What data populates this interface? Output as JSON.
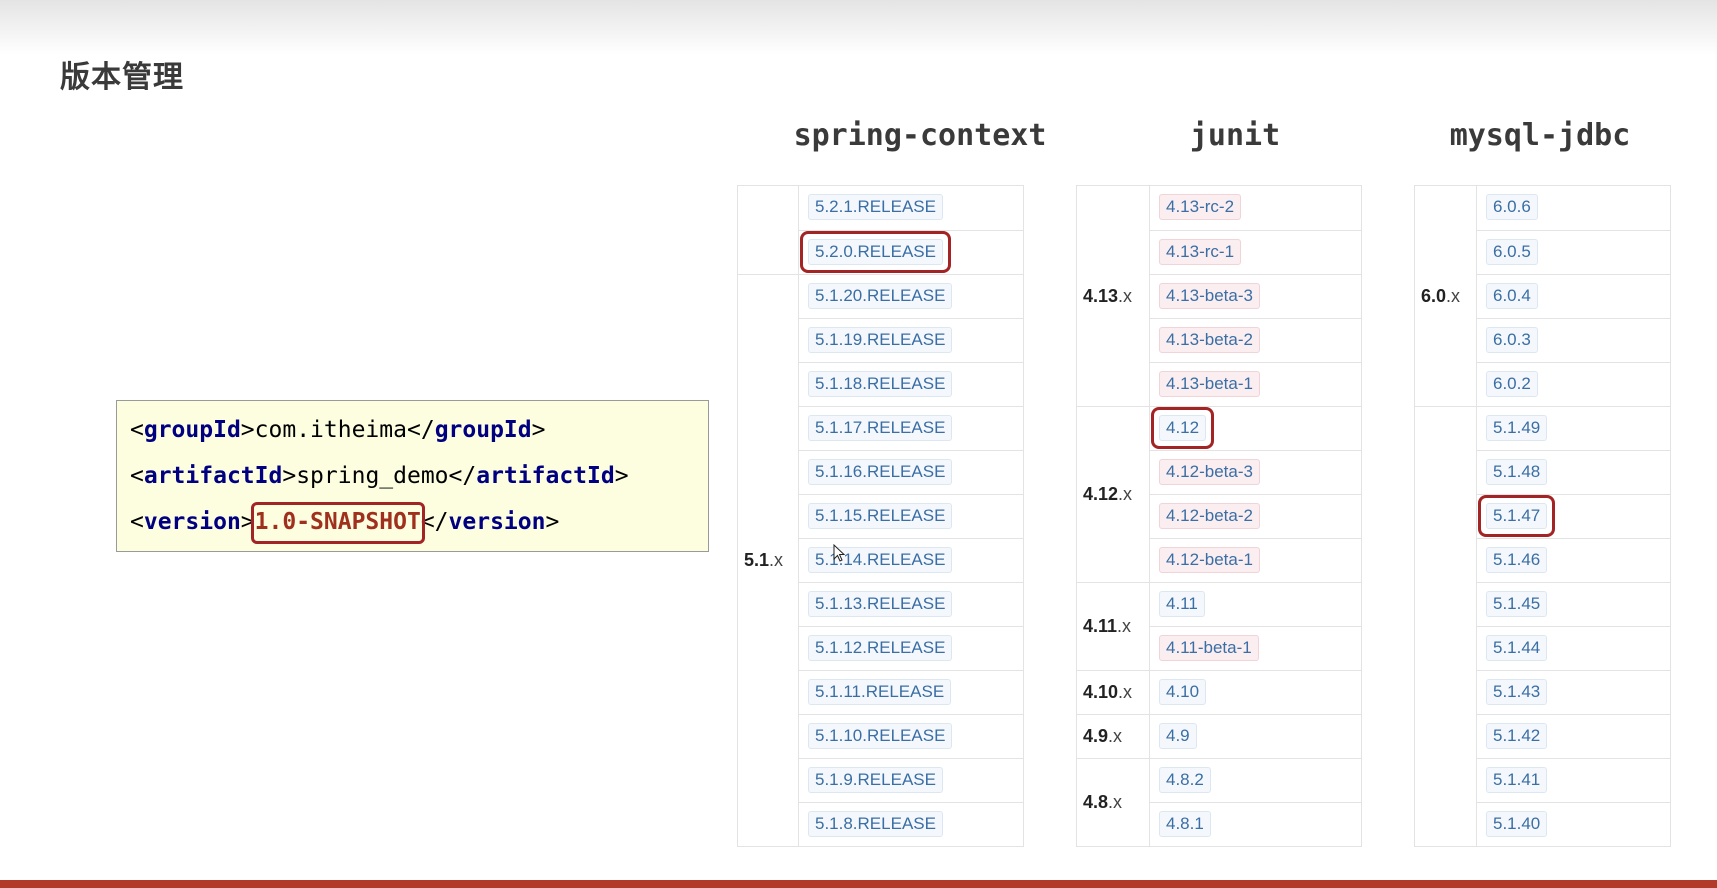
{
  "title": "版本管理",
  "code": {
    "lines": [
      {
        "open": "groupId",
        "value": "com.itheima",
        "close": "groupId"
      },
      {
        "open": "artifactId",
        "value": "spring_demo",
        "close": "artifactId"
      },
      {
        "open": "version",
        "value": "1.0-SNAPSHOT",
        "close": "version"
      }
    ]
  },
  "columns": [
    {
      "name": "spring-context",
      "groups": [
        {
          "label": "",
          "suffix": "",
          "versions": [
            "5.2.1.RELEASE",
            "5.2.0.RELEASE"
          ]
        },
        {
          "label": "5.1",
          "suffix": ".x",
          "versions": [
            "5.1.20.RELEASE",
            "5.1.19.RELEASE",
            "5.1.18.RELEASE",
            "5.1.17.RELEASE",
            "5.1.16.RELEASE",
            "5.1.15.RELEASE",
            "5.1.14.RELEASE",
            "5.1.13.RELEASE",
            "5.1.12.RELEASE",
            "5.1.11.RELEASE",
            "5.1.10.RELEASE",
            "5.1.9.RELEASE",
            "5.1.8.RELEASE"
          ]
        }
      ],
      "highlighted": "5.2.0.RELEASE"
    },
    {
      "name": "junit",
      "groups": [
        {
          "label": "4.13",
          "suffix": ".x",
          "versions": [
            "4.13-rc-2",
            "4.13-rc-1",
            "4.13-beta-3",
            "4.13-beta-2",
            "4.13-beta-1"
          ]
        },
        {
          "label": "4.12",
          "suffix": ".x",
          "versions": [
            "4.12",
            "4.12-beta-3",
            "4.12-beta-2",
            "4.12-beta-1"
          ]
        },
        {
          "label": "4.11",
          "suffix": ".x",
          "versions": [
            "4.11",
            "4.11-beta-1"
          ]
        },
        {
          "label": "4.10",
          "suffix": ".x",
          "versions": [
            "4.10"
          ]
        },
        {
          "label": "4.9",
          "suffix": ".x",
          "versions": [
            "4.9"
          ]
        },
        {
          "label": "4.8",
          "suffix": ".x",
          "versions": [
            "4.8.2",
            "4.8.1"
          ]
        }
      ],
      "highlighted": "4.12"
    },
    {
      "name": "mysql-jdbc",
      "groups": [
        {
          "label": "6.0",
          "suffix": ".x",
          "versions": [
            "6.0.6",
            "6.0.5",
            "6.0.4",
            "6.0.3",
            "6.0.2"
          ]
        },
        {
          "label": "",
          "suffix": "",
          "versions": [
            "5.1.49",
            "5.1.48",
            "5.1.47",
            "5.1.46",
            "5.1.45",
            "5.1.44",
            "5.1.43",
            "5.1.42",
            "5.1.41",
            "5.1.40"
          ]
        }
      ],
      "highlighted": "5.1.47"
    }
  ],
  "colors": {
    "highlight": "#a32424",
    "link": "#3a6ea5",
    "pink_pill": "#fbeef0",
    "blue_pill": "#f4f8fc",
    "bottom_bar": "#b23a2a"
  }
}
